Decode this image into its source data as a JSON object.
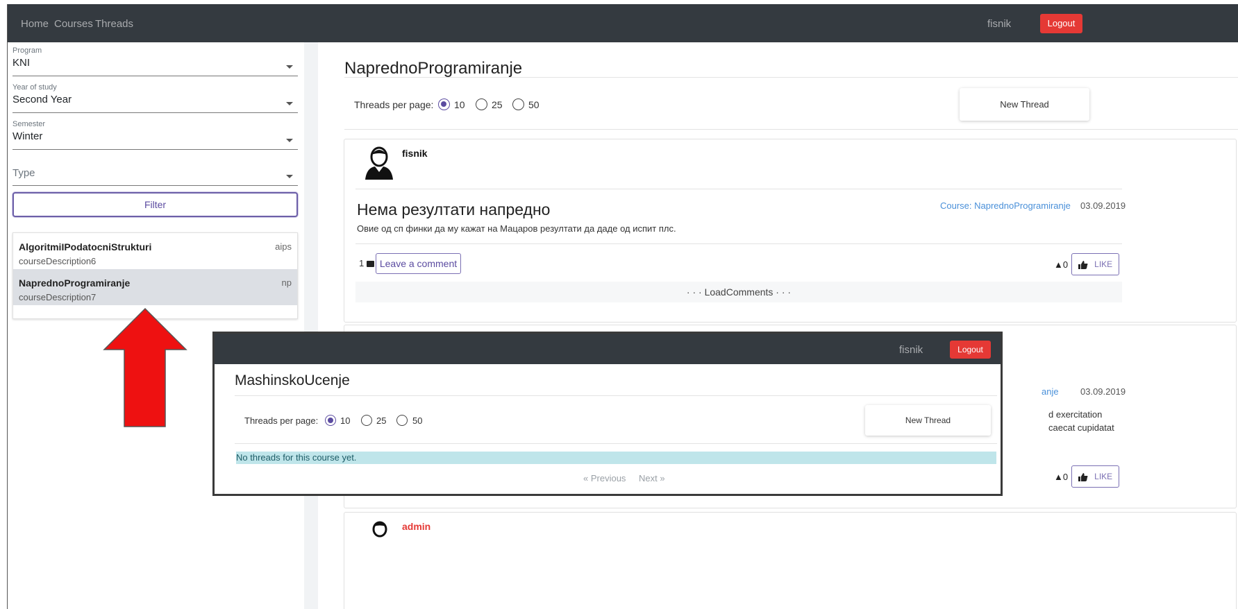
{
  "nav": {
    "links": [
      "Home",
      "Courses",
      "Threads"
    ],
    "user": "fisnik",
    "logout": "Logout"
  },
  "filters": {
    "program": {
      "label": "Program",
      "value": "KNI"
    },
    "year": {
      "label": "Year of study",
      "value": "Second Year"
    },
    "semester": {
      "label": "Semester",
      "value": "Winter"
    },
    "type": {
      "placeholder": "Type"
    },
    "filter_button": "Filter"
  },
  "courses": [
    {
      "name": "AlgoritmiIPodatocniStrukturi",
      "description": "courseDescription6",
      "code": "aips",
      "selected": false
    },
    {
      "name": "NaprednoProgramiranje",
      "description": "courseDescription7",
      "code": "np",
      "selected": true
    }
  ],
  "main": {
    "title": "NaprednoProgramiranje",
    "threads_per_page_label": "Threads per page:",
    "page_sizes": [
      "10",
      "25",
      "50"
    ],
    "selected_page_size": "10",
    "new_thread": "New Thread"
  },
  "thread": {
    "author": "fisnik",
    "title": "Нема резултати напредно",
    "course": "Course: NaprednoProgramiranje",
    "date": "03.09.2019",
    "body": "Овие од сп финки да му кажат на Мацаров резултати да даде од испит плс.",
    "comment_count": "1",
    "leave_comment": "Leave a comment",
    "votes": "▲0",
    "like": "LIKE",
    "load_comments": "· · · LoadComments · · ·"
  },
  "thread2_partial": {
    "course_fragment": "anje",
    "date": "03.09.2019",
    "body_line1": "d exercitation",
    "body_line2": "caecat cupidatat",
    "votes": "▲0",
    "like": "LIKE"
  },
  "thread3": {
    "author": "admin"
  },
  "overlay": {
    "user": "fisnik",
    "logout": "Logout",
    "title": "MashinskoUcenje",
    "threads_per_page_label": "Threads per page:",
    "page_sizes": [
      "10",
      "25",
      "50"
    ],
    "selected_page_size": "10",
    "new_thread": "New Thread",
    "empty_message": "No threads for this course yet.",
    "previous": "« Previous",
    "next": "Next »"
  },
  "colors": {
    "navbar": "#343a40",
    "logout": "#e53935",
    "accent": "#5b4ba0",
    "link": "#4a90d9",
    "arrow": "#ee1111",
    "info_alert": "#bfe5ea"
  }
}
